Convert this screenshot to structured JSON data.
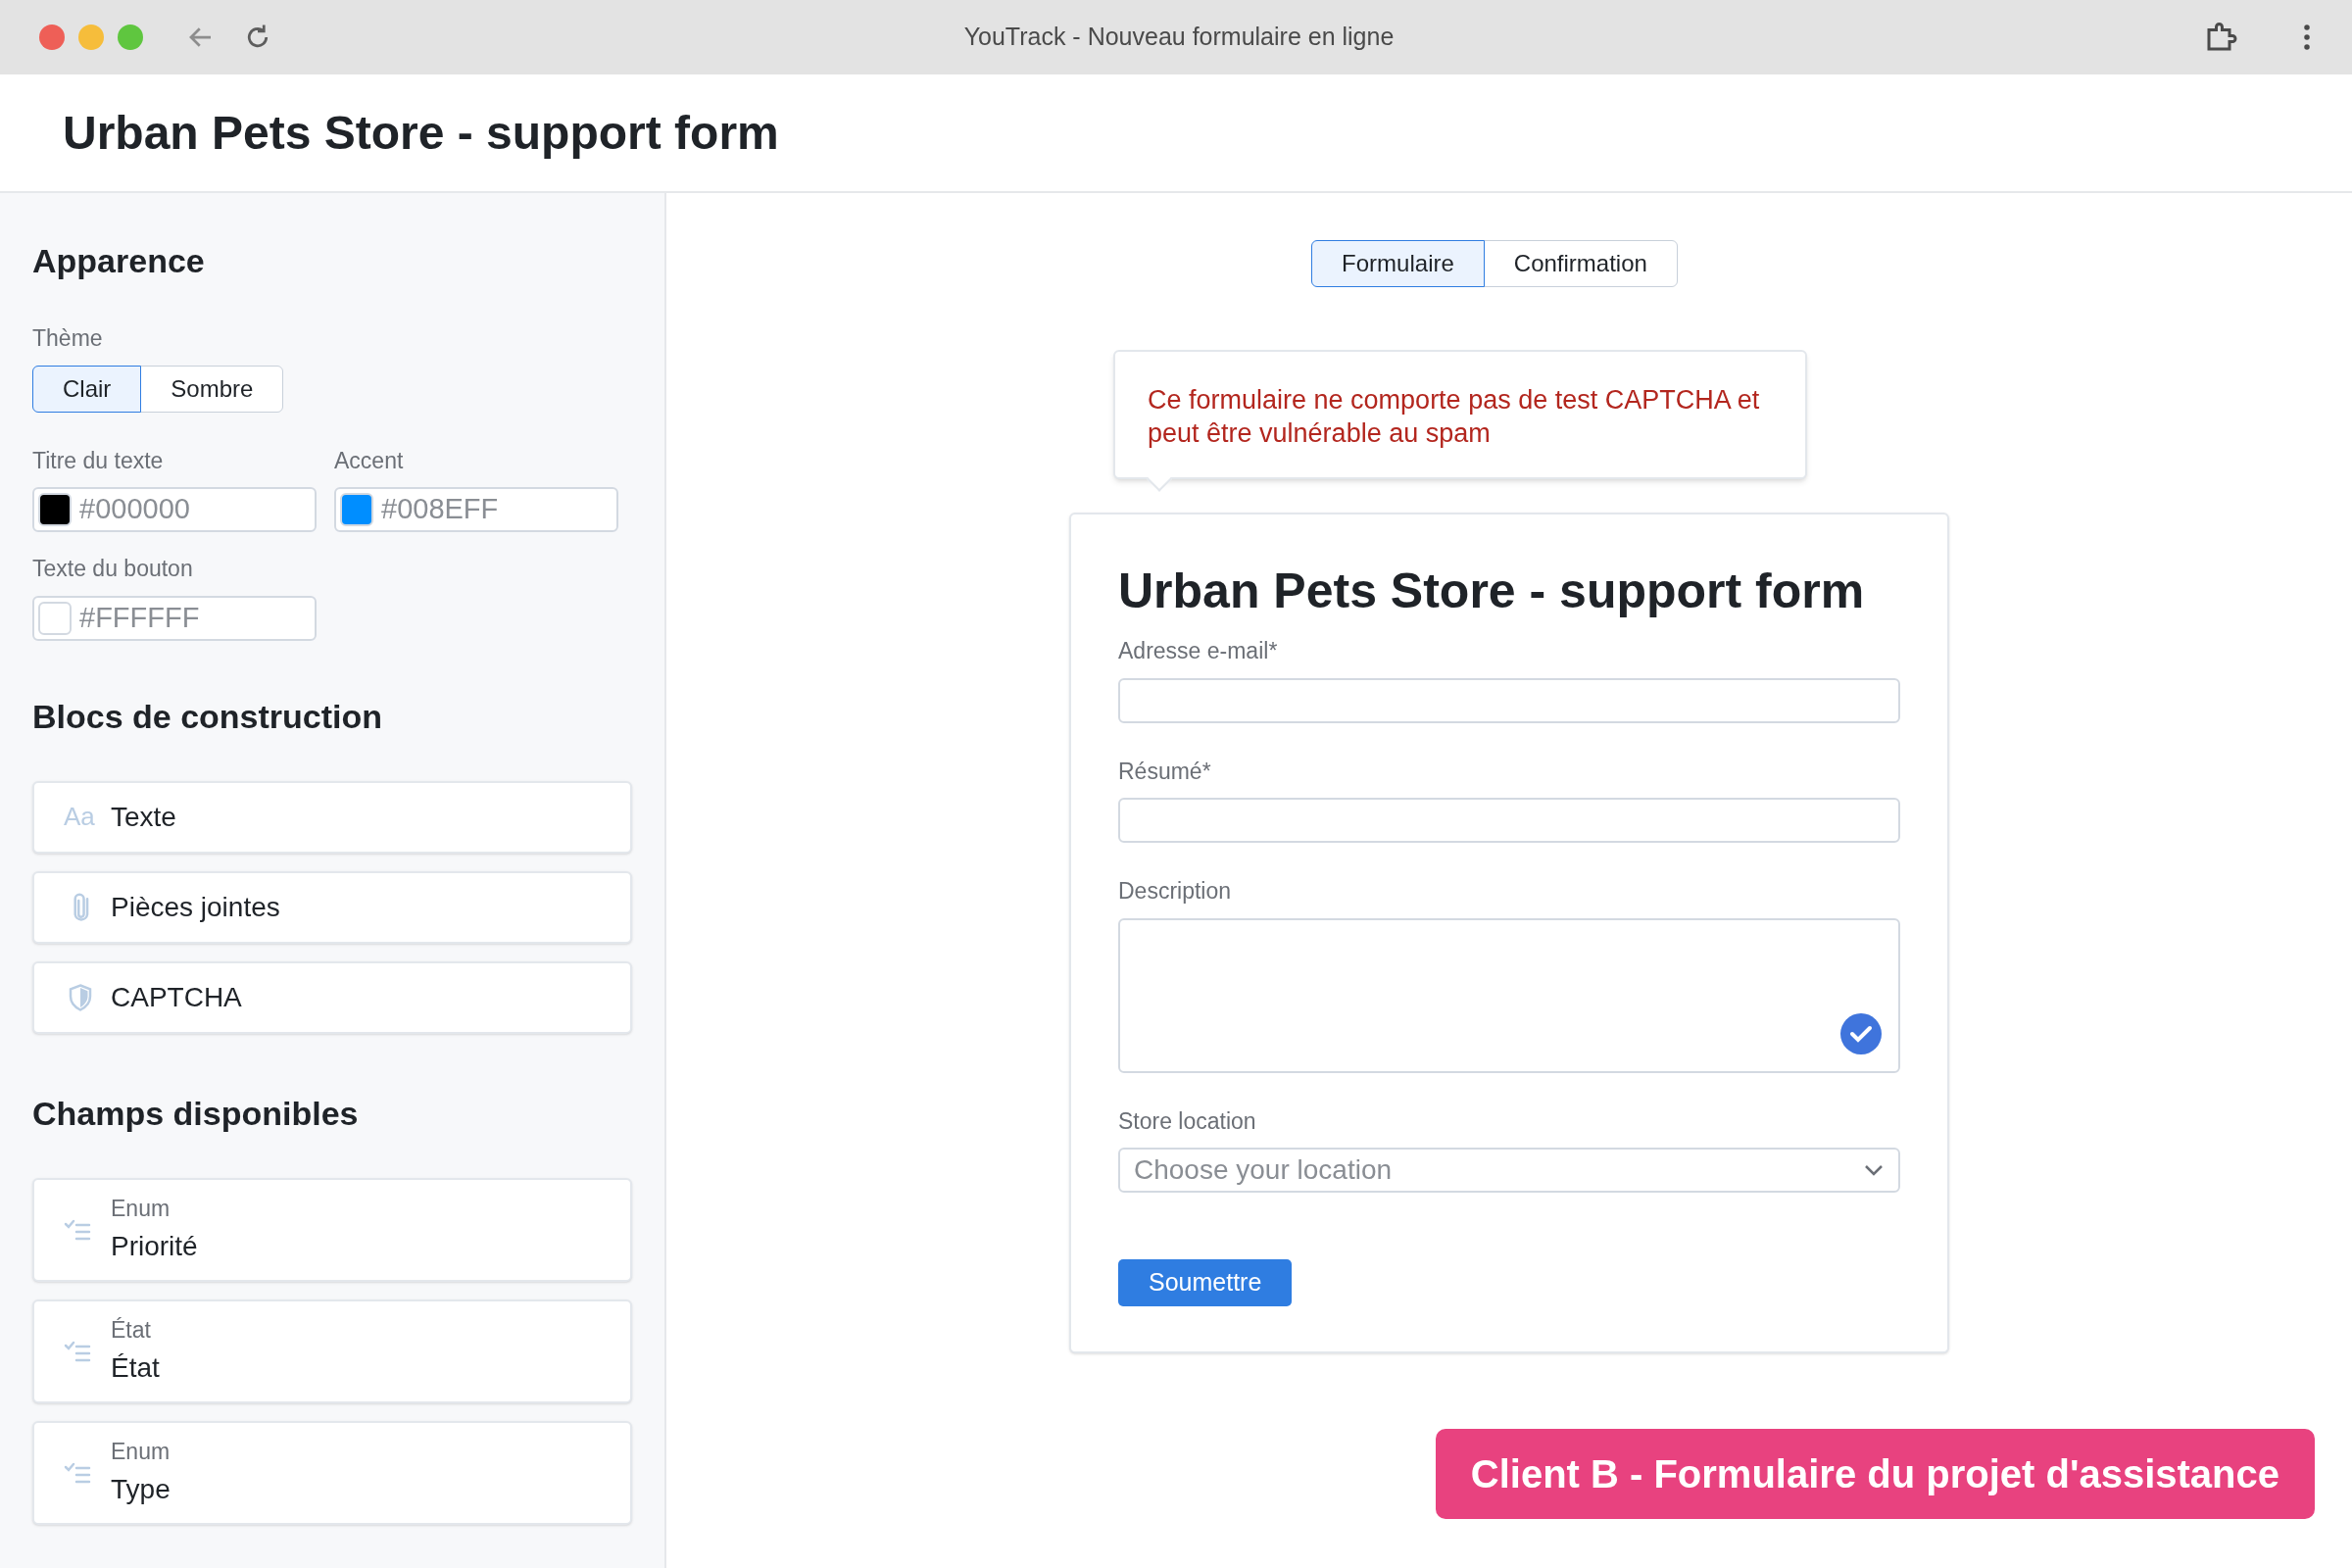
{
  "browser": {
    "title": "YouTrack - Nouveau formulaire en ligne"
  },
  "page_title": "Urban Pets Store - support form",
  "sidebar": {
    "appearance": {
      "heading": "Apparence",
      "theme_label": "Thème",
      "themes": [
        {
          "label": "Clair",
          "selected": true
        },
        {
          "label": "Sombre",
          "selected": false
        }
      ],
      "colors": [
        {
          "label": "Titre du texte",
          "value": "#000000"
        },
        {
          "label": "Accent",
          "value": "#008EFF"
        },
        {
          "label": "Texte du bouton",
          "value": "#FFFFFF"
        }
      ]
    },
    "blocks": {
      "heading": "Blocs de construction",
      "items": [
        {
          "kind": "text",
          "icon": "Aa",
          "label": "Texte"
        },
        {
          "kind": "attachments",
          "label": "Pièces jointes"
        },
        {
          "kind": "captcha",
          "label": "CAPTCHA"
        }
      ]
    },
    "fields": {
      "heading": "Champs disponibles",
      "items": [
        {
          "type": "Enum",
          "label": "Priorité"
        },
        {
          "type": "État",
          "label": "État"
        },
        {
          "type": "Enum",
          "label": "Type"
        }
      ]
    }
  },
  "preview": {
    "tabs": [
      {
        "label": "Formulaire",
        "selected": true
      },
      {
        "label": "Confirmation",
        "selected": false
      }
    ],
    "warning": "Ce formulaire ne comporte pas de test CAPTCHA et peut être vulnérable au spam",
    "form": {
      "title": "Urban Pets Store - support form",
      "fields": [
        {
          "kind": "input",
          "label": "Adresse e-mail*"
        },
        {
          "kind": "input",
          "label": "Résumé*"
        },
        {
          "kind": "textarea",
          "label": "Description"
        },
        {
          "kind": "select",
          "label": "Store location",
          "placeholder": "Choose your location"
        }
      ],
      "submit": "Soumettre"
    }
  },
  "caption": "Client B - Formulaire du projet d'assistance"
}
